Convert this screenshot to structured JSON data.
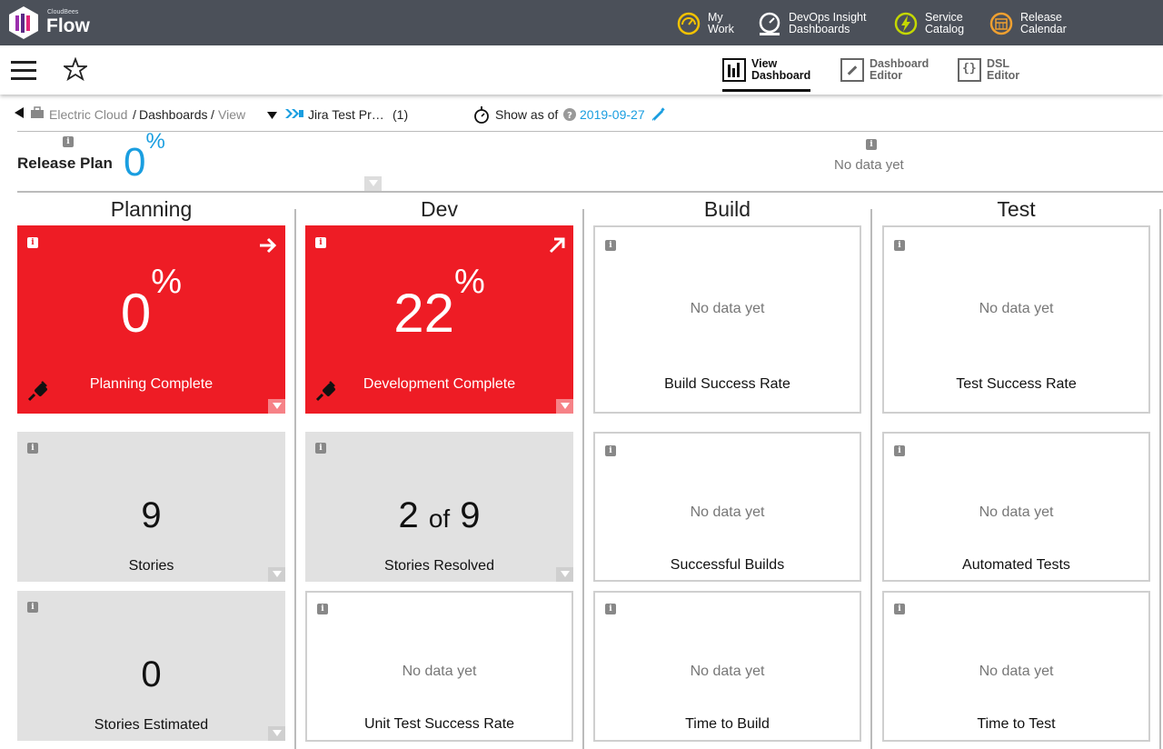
{
  "app": {
    "brand_small": "CloudBees",
    "brand_big": "Flow"
  },
  "topnav": [
    {
      "line1": "My",
      "line2": "Work",
      "icon": "dashboard-sun-icon"
    },
    {
      "line1": "DevOps Insight",
      "line2": "Dashboards",
      "icon": "gauge-icon"
    },
    {
      "line1": "Service",
      "line2": "Catalog",
      "icon": "lightning-icon"
    },
    {
      "line1": "Release",
      "line2": "Calendar",
      "icon": "calendar-icon"
    }
  ],
  "viewbar": {
    "view": {
      "line1": "View",
      "line2": "Dashboard"
    },
    "editor": {
      "line1": "Dashboard",
      "line2": "Editor"
    },
    "dsl": {
      "line1": "DSL",
      "line2": "Editor"
    }
  },
  "breadcrumb": {
    "items": [
      "Electric Cloud",
      "/",
      "Dashboards",
      "/",
      "View"
    ],
    "project": "Jira Test Pr…",
    "project_count": "(1)",
    "show_as_of": "Show as of",
    "date": "2019-09-27"
  },
  "release_plan": {
    "label": "Release Plan",
    "value": "0",
    "unit": "%",
    "nodata": "No data yet"
  },
  "columns": [
    {
      "title": "Planning",
      "tiles": [
        {
          "value": "0",
          "unit": "%",
          "label": "Planning Complete"
        },
        {
          "value": "9",
          "label": "Stories"
        },
        {
          "value": "0",
          "label": "Stories Estimated"
        }
      ]
    },
    {
      "title": "Dev",
      "tiles": [
        {
          "value": "22",
          "unit": "%",
          "label": "Development Complete"
        },
        {
          "value_a": "2",
          "of": "of",
          "value_b": "9",
          "label": "Stories Resolved"
        },
        {
          "nodata": "No data yet",
          "label": "Unit Test Success Rate"
        }
      ]
    },
    {
      "title": "Build",
      "tiles": [
        {
          "nodata": "No data yet",
          "label": "Build Success Rate"
        },
        {
          "nodata": "No data yet",
          "label": "Successful Builds"
        },
        {
          "nodata": "No data yet",
          "label": "Time to Build"
        }
      ]
    },
    {
      "title": "Test",
      "tiles": [
        {
          "nodata": "No data yet",
          "label": "Test Success Rate"
        },
        {
          "nodata": "No data yet",
          "label": "Automated Tests"
        },
        {
          "nodata": "No data yet",
          "label": "Time to Test"
        }
      ]
    }
  ],
  "colors": {
    "topbar": "#4b5059",
    "accent": "#1a9ee0",
    "alert": "#ee1c25",
    "nav_icon": "#f2c200"
  }
}
